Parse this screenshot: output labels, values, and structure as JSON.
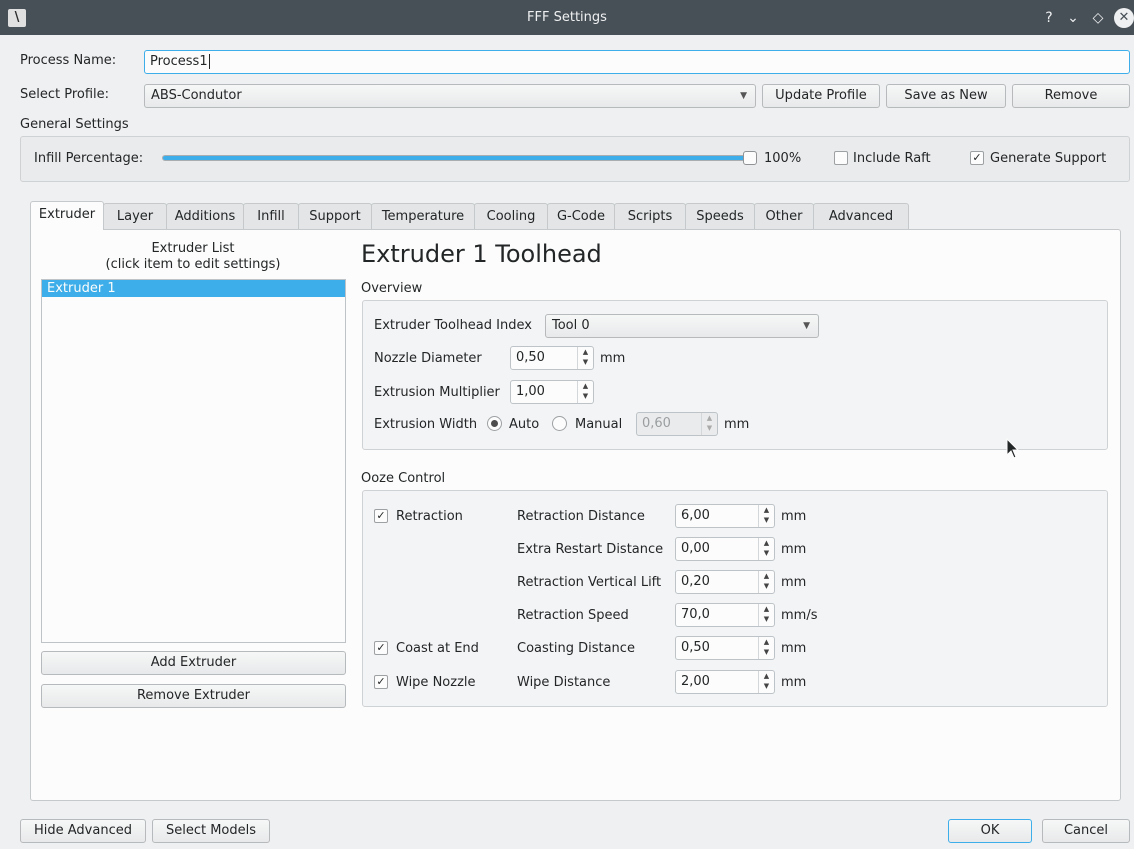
{
  "window": {
    "title": "FFF Settings",
    "help_glyph": "?",
    "minimize_glyph": "⌄",
    "maximize_glyph": "◇",
    "close_glyph": "✕",
    "app_glyph": "\\"
  },
  "process_name": {
    "label": "Process Name:",
    "value": "Process1"
  },
  "select_profile": {
    "label": "Select Profile:",
    "value": "ABS-Condutor"
  },
  "profile_buttons": {
    "update": "Update Profile",
    "save_new": "Save as New",
    "remove": "Remove"
  },
  "general": {
    "title": "General Settings",
    "infill_label": "Infill Percentage:",
    "infill_value": "100%",
    "infill_fraction": 1.0,
    "include_raft": "Include Raft",
    "include_raft_checked": false,
    "generate_support": "Generate Support",
    "generate_support_checked": true
  },
  "tabs": [
    "Extruder",
    "Layer",
    "Additions",
    "Infill",
    "Support",
    "Temperature",
    "Cooling",
    "G-Code",
    "Scripts",
    "Speeds",
    "Other",
    "Advanced"
  ],
  "extruder_list": {
    "title_line1": "Extruder List",
    "title_line2": "(click item to edit settings)",
    "items": [
      "Extruder 1"
    ],
    "add_button": "Add Extruder",
    "remove_button": "Remove Extruder"
  },
  "toolhead": {
    "heading": "Extruder 1 Toolhead",
    "overview_title": "Overview",
    "index_label": "Extruder Toolhead Index",
    "index_value": "Tool 0",
    "nozzle_label": "Nozzle Diameter",
    "nozzle_value": "0,50",
    "nozzle_unit": "mm",
    "mult_label": "Extrusion Multiplier",
    "mult_value": "1,00",
    "width_label": "Extrusion Width",
    "width_auto": "Auto",
    "width_manual": "Manual",
    "width_value": "0,60",
    "width_unit": "mm"
  },
  "ooze": {
    "title": "Ooze Control",
    "retraction": "Retraction",
    "coast": "Coast at End",
    "wipe": "Wipe Nozzle",
    "rows": [
      {
        "label": "Retraction Distance",
        "value": "6,00",
        "unit": "mm"
      },
      {
        "label": "Extra Restart Distance",
        "value": "0,00",
        "unit": "mm"
      },
      {
        "label": "Retraction Vertical Lift",
        "value": "0,20",
        "unit": "mm"
      },
      {
        "label": "Retraction Speed",
        "value": "70,0",
        "unit": "mm/s"
      },
      {
        "label": "Coasting Distance",
        "value": "0,50",
        "unit": "mm"
      },
      {
        "label": "Wipe Distance",
        "value": "2,00",
        "unit": "mm"
      }
    ]
  },
  "footer": {
    "hide_advanced": "Hide Advanced",
    "select_models": "Select Models",
    "ok": "OK",
    "cancel": "Cancel"
  },
  "colors": {
    "accent": "#3daee9",
    "titlebar": "#475057",
    "background": "#eff0f1"
  }
}
